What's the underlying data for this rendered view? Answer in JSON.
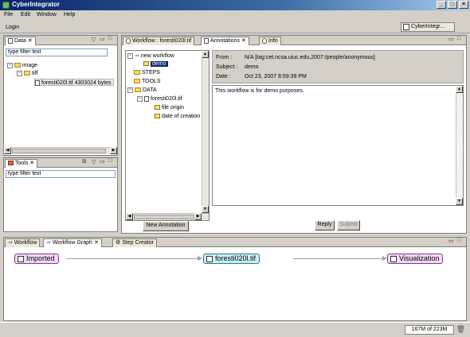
{
  "window": {
    "title": "CyberIntegrator"
  },
  "menu": [
    "File",
    "Edit",
    "Window",
    "Help"
  ],
  "toolbar": {
    "login_label": "Login",
    "perspective_label": "CyberIntegr..."
  },
  "data_panel": {
    "tab_label": "Data",
    "filter_text": "type filter text",
    "tree": [
      {
        "label": "image"
      },
      {
        "label": "tiff"
      },
      {
        "label": "foresti020l.tif 4303024 bytes"
      }
    ]
  },
  "tools_panel": {
    "tab_label": "Tools",
    "filter_text": "type filter text"
  },
  "editor": {
    "tabs": [
      "Workflow : foresti020l.tif",
      "Annotations",
      "Info"
    ],
    "tree": [
      {
        "label": "new workflow"
      },
      {
        "label": "demo"
      },
      {
        "label": "STEPS"
      },
      {
        "label": "TOOLS"
      },
      {
        "label": "DATA"
      },
      {
        "label": "foresti020l.tif"
      },
      {
        "label": "file origin"
      },
      {
        "label": "date of creation"
      }
    ],
    "new_annotation_label": "New Annotation",
    "annotation": {
      "from_label": "From :",
      "from_value": "N/A [tag:cet.ncsa.uiuc.edu,2007:/people/anonymous]",
      "subject_label": "Subject :",
      "subject_value": "demo",
      "date_label": "Date :",
      "date_value": "Oct 23, 2007 8:59:39 PM",
      "body": "This workflow is for demo purposes."
    },
    "reply_label": "Reply",
    "submit_label": "Submit"
  },
  "bottom": {
    "tabs": [
      "Workflow",
      "Workflow Graph",
      "Step Creator"
    ],
    "graph_nodes": [
      "Imported",
      "foresti020l.tif",
      "Visualization"
    ],
    "node_colors": {
      "imported": "#f4d8f8",
      "file": "#c8f0f8",
      "visualization": "#f4d8f8"
    }
  },
  "status": {
    "memory": "167M of 223M"
  }
}
